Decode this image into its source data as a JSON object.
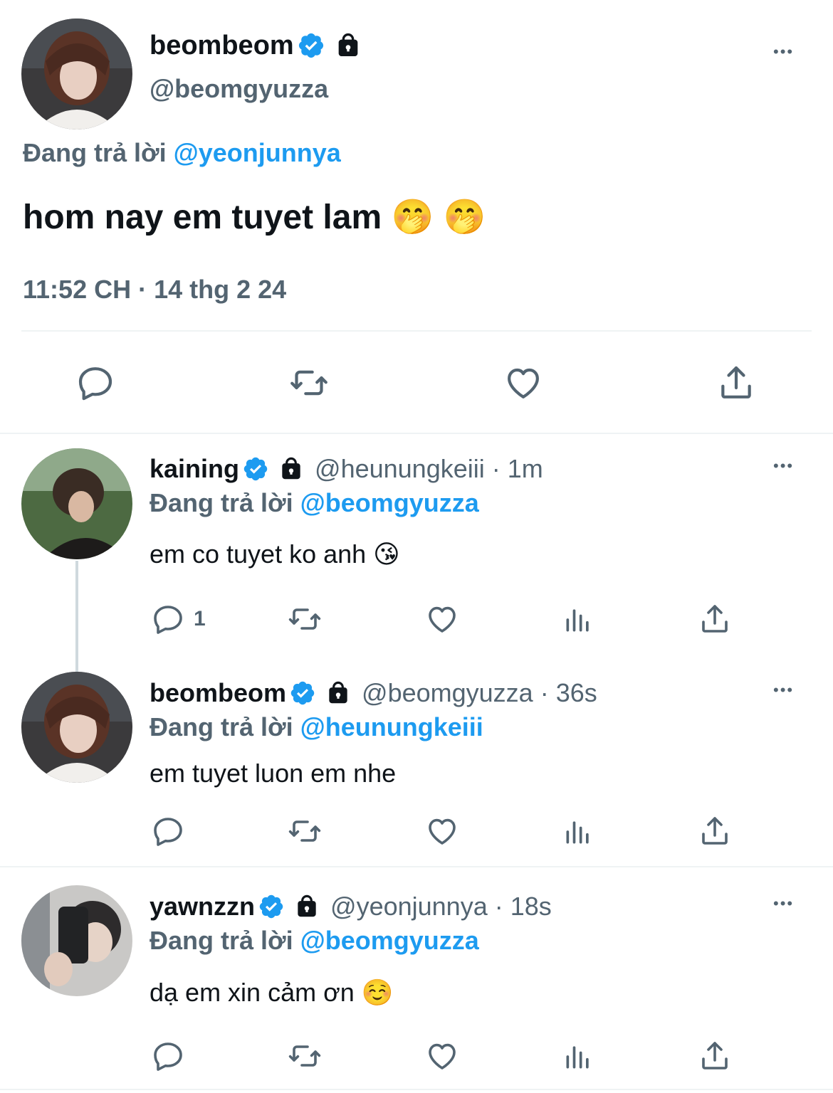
{
  "main_tweet": {
    "display_name": "beombeom",
    "handle": "@beomgyuzza",
    "replying_label": "Đang trả lời",
    "replying_to": "@yeonjunnya",
    "text": "hom nay em tuyet lam 🤭 🤭",
    "timestamp": "11:52 CH · 14 thg 2 24",
    "more": "•••"
  },
  "replies": [
    {
      "display_name": "kaining",
      "handle": "@heunungkeiii",
      "time": "· 1m",
      "replying_label": "Đang trả lời",
      "replying_to": "@beomgyuzza",
      "text": "em co tuyet ko anh 😘",
      "reply_count": "1",
      "more": "•••"
    },
    {
      "display_name": "beombeom",
      "handle": "@beomgyuzza",
      "time": "· 36s",
      "replying_label": "Đang trả lời",
      "replying_to": "@heunungkeiii",
      "text": "em tuyet luon em nhe",
      "reply_count": "",
      "more": "•••"
    },
    {
      "display_name": "yawnzzn",
      "handle": "@yeonjunnya",
      "time": "· 18s",
      "replying_label": "Đang trả lời",
      "replying_to": "@beomgyuzza",
      "text": "dạ em xin cảm ơn ☺️",
      "reply_count": "",
      "more": "•••"
    }
  ],
  "colors": {
    "accent": "#1d9bf0",
    "secondary_text": "#536471",
    "divider": "#eff3f4"
  },
  "icons": [
    "verified-badge-icon",
    "lock-icon",
    "more-icon",
    "reply-icon",
    "retweet-icon",
    "like-icon",
    "views-icon",
    "share-icon"
  ]
}
